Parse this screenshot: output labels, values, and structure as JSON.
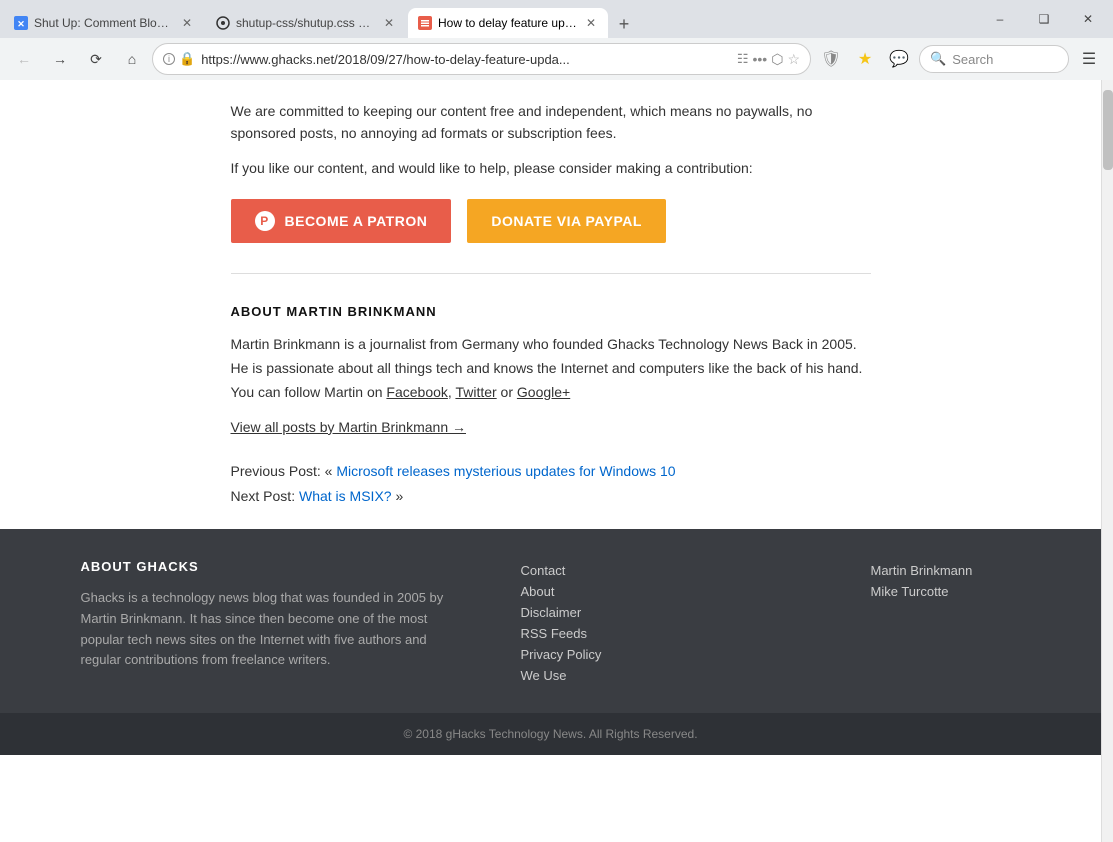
{
  "browser": {
    "tabs": [
      {
        "id": "tab1",
        "label": "Shut Up: Comment Blocker – A",
        "favicon_color": "#4285f4",
        "active": false
      },
      {
        "id": "tab2",
        "label": "shutup-css/shutup.css at mast",
        "favicon_color": "#333",
        "active": false
      },
      {
        "id": "tab3",
        "label": "How to delay feature updates",
        "favicon_color": "#e85d4a",
        "active": true
      }
    ],
    "window_controls": {
      "minimize": "–",
      "maximize": "❑",
      "close": "✕"
    },
    "address_bar": {
      "url": "https://www.ghacks.net/2018/09/27/how-to-delay-feature-upda...",
      "protocol": "https"
    },
    "search_placeholder": "Search",
    "new_tab_label": "+"
  },
  "page": {
    "support": {
      "text1": "We are committed to keeping our content free and independent, which means no paywalls, no sponsored posts, no annoying ad formats or subscription fees.",
      "text2": "If you like our content, and would like to help, please consider making a contribution:",
      "btn_patron": "BECOME A PATRON",
      "btn_paypal": "DONATE VIA PAYPAL"
    },
    "author": {
      "heading": "ABOUT MARTIN BRINKMANN",
      "bio": "Martin Brinkmann is a journalist from Germany who founded Ghacks Technology News Back in 2005. He is passionate about all things tech and knows the Internet and computers like the back of his hand. You can follow Martin on ",
      "facebook": "Facebook",
      "twitter": "Twitter",
      "google_plus": "Google+",
      "bio_join": " or ",
      "bio_comma": ", ",
      "view_posts": "View all posts by Martin Brinkmann →"
    },
    "post_nav": {
      "previous_label": "Previous Post: «",
      "previous_link": "Microsoft releases mysterious updates for Windows 10",
      "next_label": "Next Post:",
      "next_link": "What is MSIX?",
      "next_suffix": "»"
    }
  },
  "footer": {
    "about_heading": "ABOUT GHACKS",
    "about_text": "Ghacks is a technology news blog that was founded in 2005 by Martin Brinkmann. It has since then become one of the most popular tech news sites on the Internet with five authors and regular contributions from freelance writers.",
    "links": [
      "Contact",
      "About",
      "Disclaimer",
      "RSS Feeds",
      "Privacy Policy",
      "We Use"
    ],
    "authors": [
      "Martin Brinkmann",
      "Mike Turcotte"
    ],
    "copyright": "© 2018 gHacks Technology News. All Rights Reserved."
  }
}
